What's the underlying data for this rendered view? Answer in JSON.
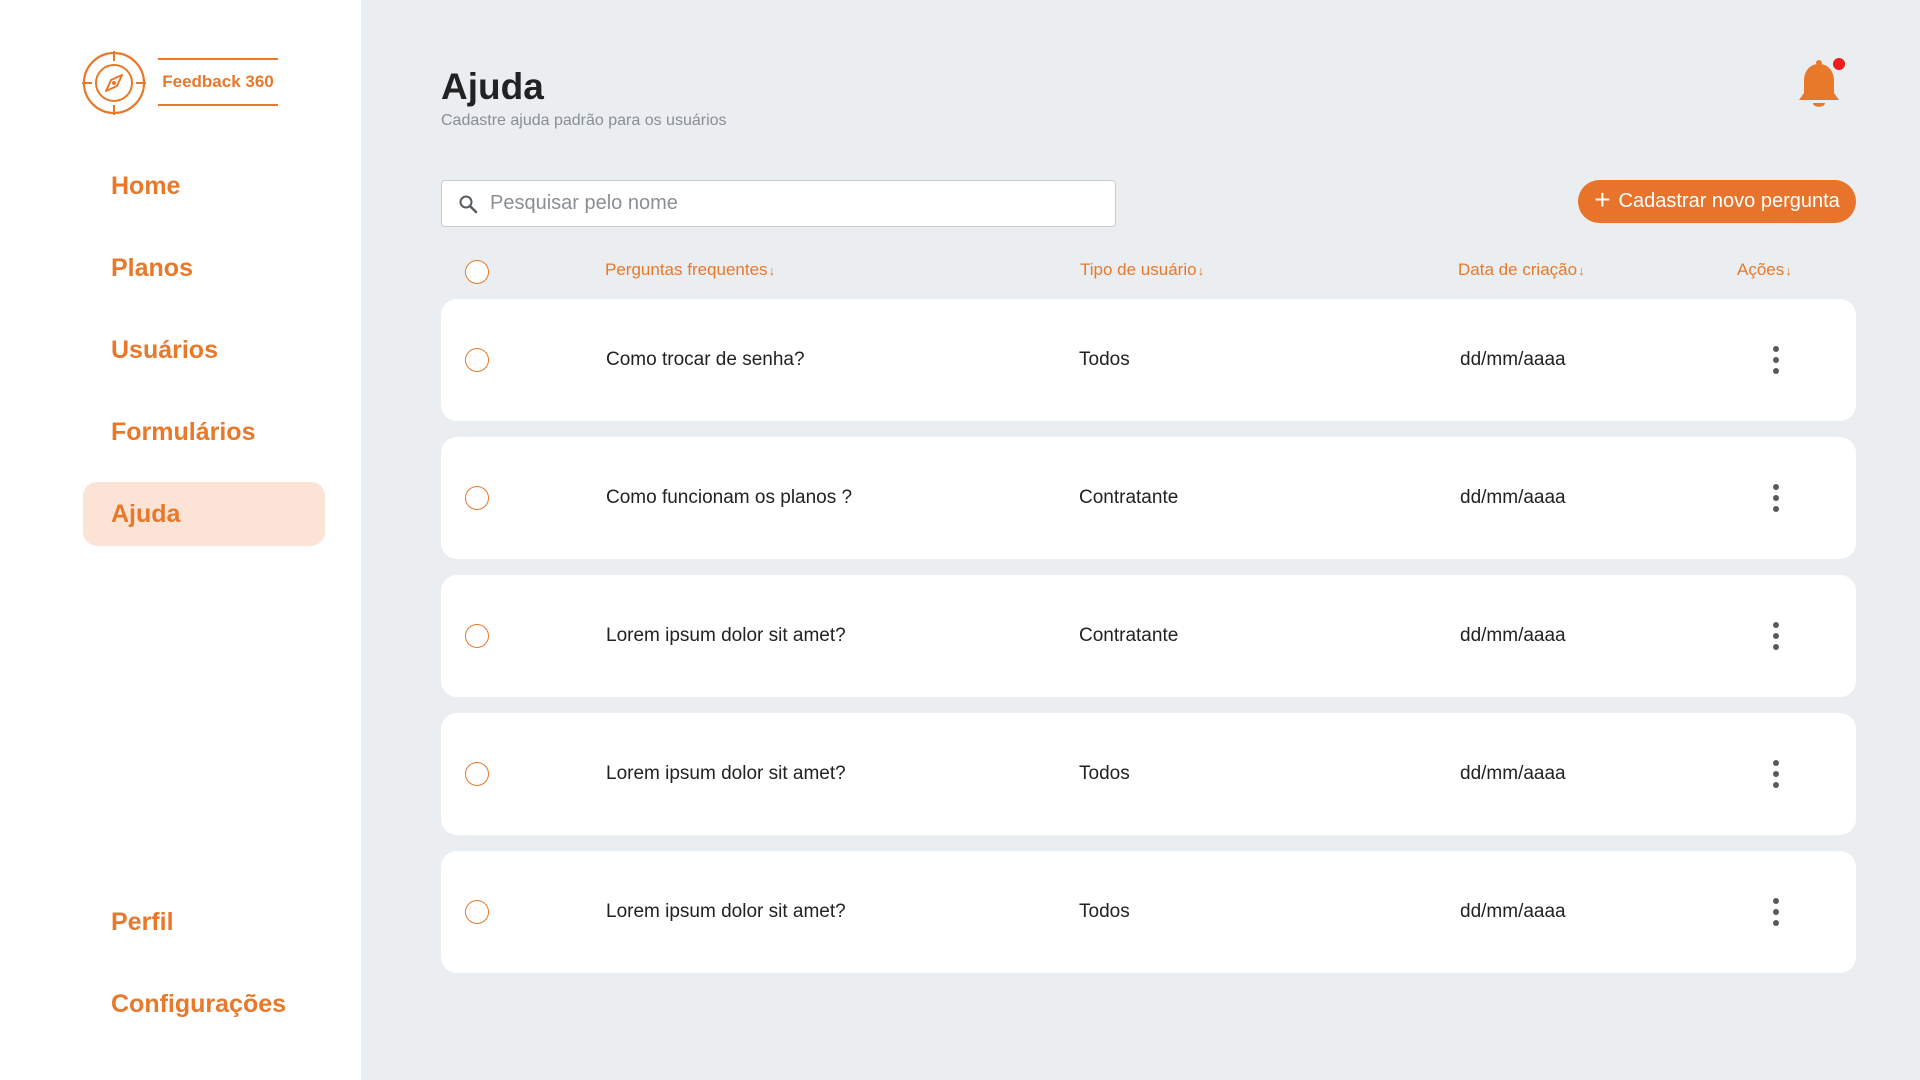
{
  "brand": {
    "name": "Feedback 360",
    "accent_color": "#e8782a",
    "logo_icon": "compass-icon"
  },
  "sidebar": {
    "items": [
      {
        "label": "Home",
        "active": false
      },
      {
        "label": "Planos",
        "active": false
      },
      {
        "label": "Usuários",
        "active": false
      },
      {
        "label": "Formulários",
        "active": false
      },
      {
        "label": "Ajuda",
        "active": true
      }
    ],
    "bottom_items": [
      {
        "label": "Perfil"
      },
      {
        "label": "Configurações"
      }
    ]
  },
  "header": {
    "title": "Ajuda",
    "subtitle": "Cadastre ajuda padrão para os usuários",
    "notification_icon": "bell-icon",
    "has_unread_notification": true
  },
  "toolbar": {
    "search_placeholder": "Pesquisar pelo nome",
    "search_value": "",
    "add_button_label": "Cadastrar novo pergunta"
  },
  "table": {
    "columns": [
      {
        "label": "Perguntas frequentes"
      },
      {
        "label": "Tipo de usuário"
      },
      {
        "label": "Data de criação"
      },
      {
        "label": "Ações"
      }
    ],
    "sort_arrow": "↓",
    "rows": [
      {
        "question": "Como trocar de senha?",
        "user_type": "Todos",
        "created": "dd/mm/aaaa"
      },
      {
        "question": "Como funcionam os planos ?",
        "user_type": "Contratante",
        "created": "dd/mm/aaaa"
      },
      {
        "question": "Lorem ipsum dolor sit amet?",
        "user_type": "Contratante",
        "created": "dd/mm/aaaa"
      },
      {
        "question": "Lorem ipsum dolor sit amet?",
        "user_type": "Todos",
        "created": "dd/mm/aaaa"
      },
      {
        "question": "Lorem ipsum dolor sit amet?",
        "user_type": "Todos",
        "created": "dd/mm/aaaa"
      }
    ]
  }
}
